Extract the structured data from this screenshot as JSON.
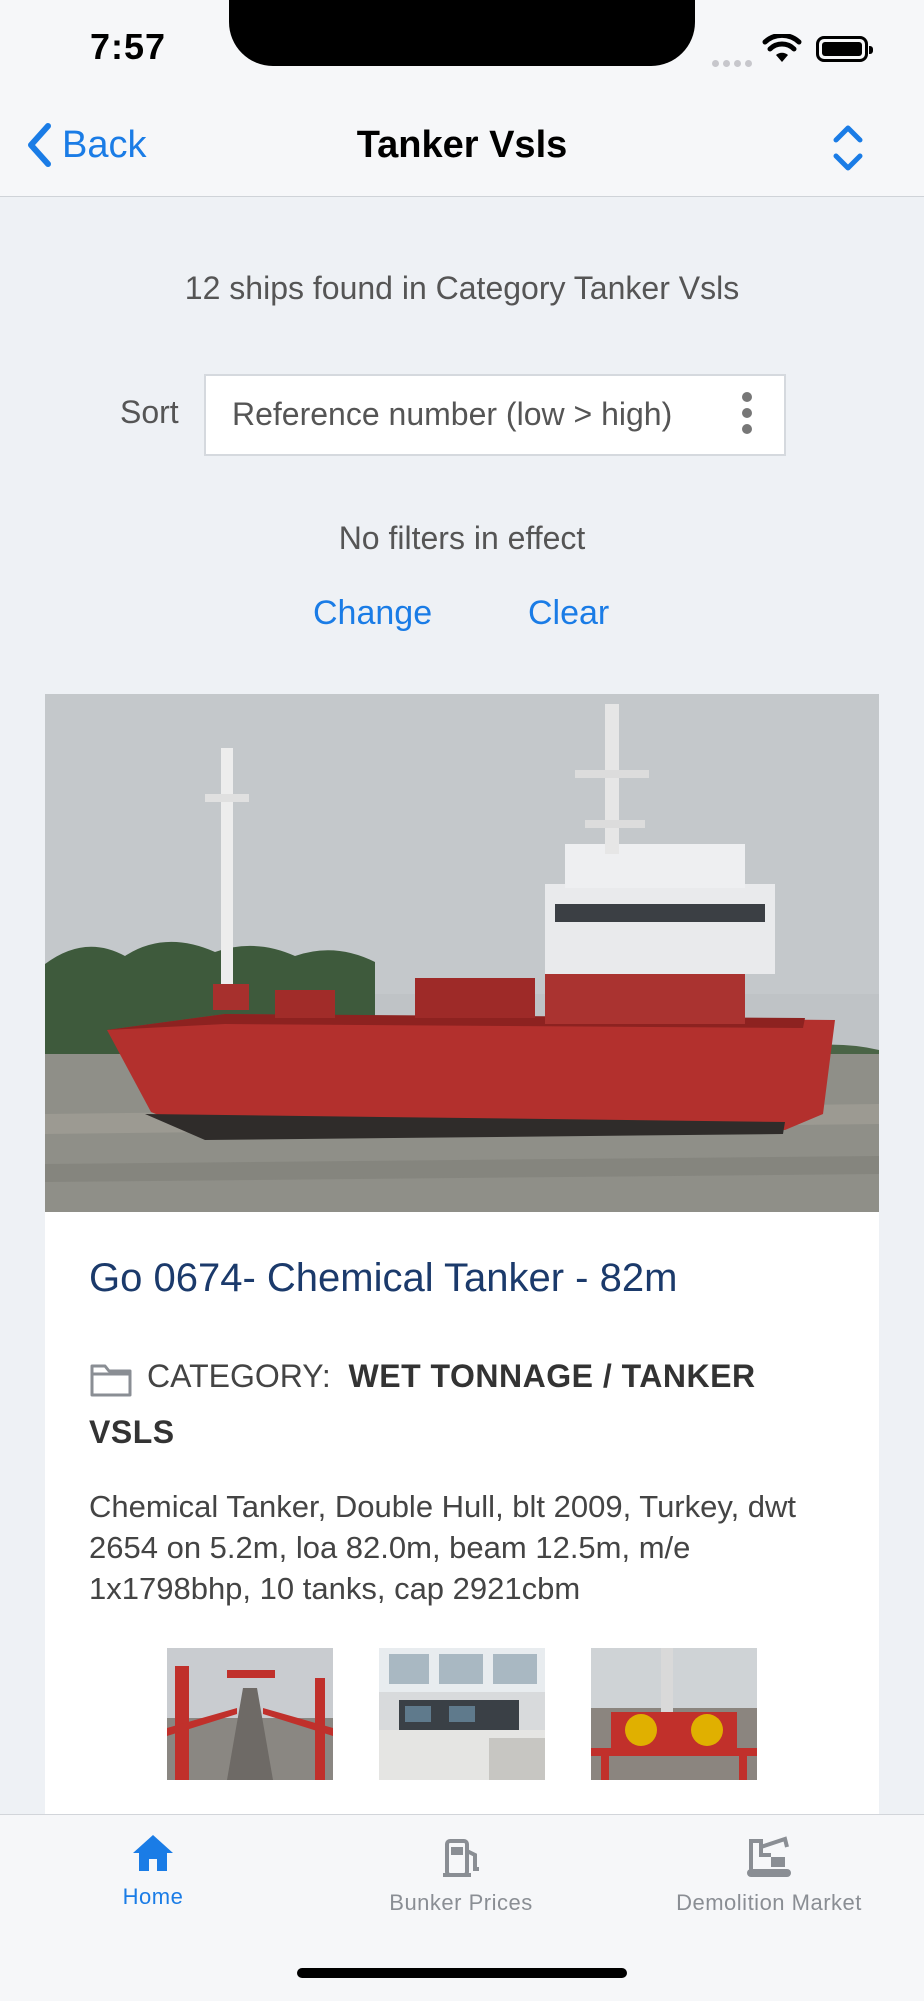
{
  "status": {
    "time": "7:57"
  },
  "nav": {
    "back_label": "Back",
    "title": "Tanker Vsls"
  },
  "summary": "12 ships found in Category Tanker Vsls",
  "sort": {
    "label": "Sort",
    "value": "Reference number (low > high)"
  },
  "filters": {
    "status": "No filters in effect",
    "change_label": "Change",
    "clear_label": "Clear"
  },
  "listing": {
    "title": "Go 0674- Chemical Tanker - 82m",
    "category_label": "CATEGORY:",
    "category_path": "WET TONNAGE / TANKER VSLS",
    "description": "Chemical Tanker, Double Hull, blt 2009, Turkey, dwt 2654 on 5.2m, loa 82.0m, beam 12.5m, m/e 1x1798bhp, 10 tanks, cap 2921cbm"
  },
  "tabs": [
    {
      "label": "Home",
      "icon": "home-icon",
      "active": true
    },
    {
      "label": "Bunker Prices",
      "icon": "fuel-pump-icon",
      "active": false
    },
    {
      "label": "Demolition Market",
      "icon": "crane-icon",
      "active": false
    }
  ],
  "colors": {
    "accent": "#1a7ce6",
    "title": "#1b3a6b",
    "inactive": "#8a8e94",
    "hull": "#b3302d"
  }
}
